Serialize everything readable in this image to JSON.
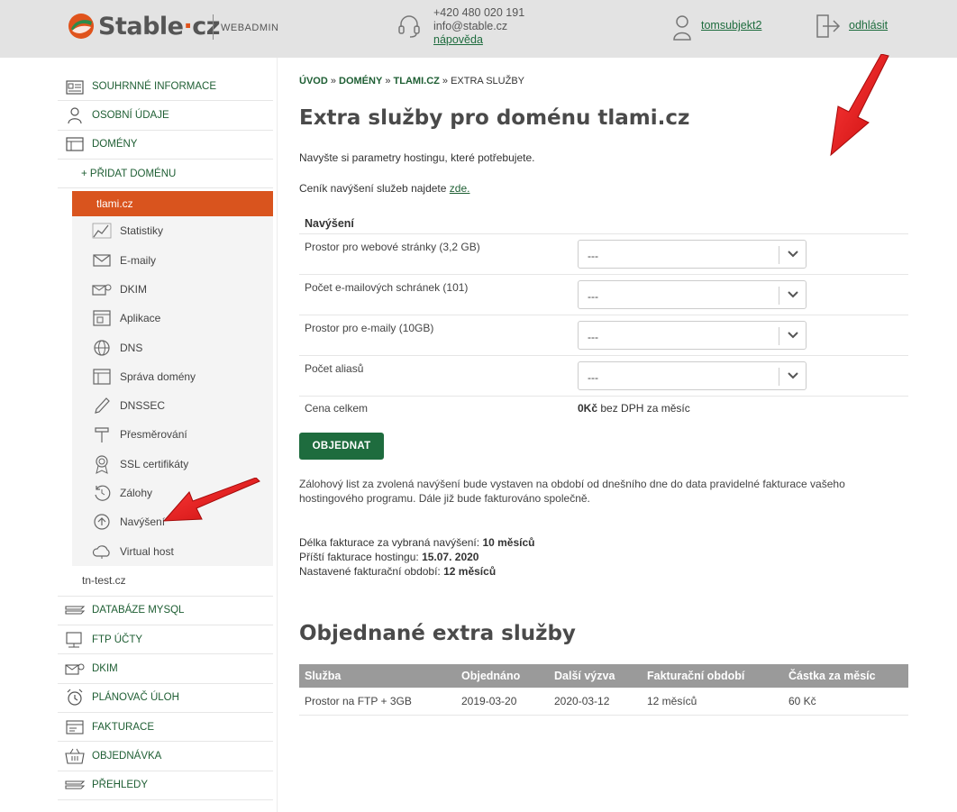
{
  "header": {
    "logo_text": "Stable",
    "logo_dot": "·",
    "logo_tld": "cz",
    "logo_sub": "WEBADMIN",
    "phone": "+420 480 020 191",
    "email": "info@stable.cz",
    "help": "nápověda",
    "user": "tomsubjekt2",
    "logout": "odhlásit"
  },
  "sidebar": {
    "items_top": [
      {
        "label": "SOUHRNNÉ INFORMACE",
        "icon": "summary-icon"
      },
      {
        "label": "OSOBNÍ ÚDAJE",
        "icon": "person-icon"
      },
      {
        "label": "DOMÉNY",
        "icon": "domains-icon"
      }
    ],
    "add_domain": "+ PŘIDAT DOMÉNU",
    "active_domain": "tlami.cz",
    "sub_items": [
      {
        "label": "Statistiky",
        "icon": "statistics-icon"
      },
      {
        "label": "E-maily",
        "icon": "mail-icon"
      },
      {
        "label": "DKIM",
        "icon": "dkim-icon"
      },
      {
        "label": "Aplikace",
        "icon": "apps-icon"
      },
      {
        "label": "DNS",
        "icon": "globe-icon"
      },
      {
        "label": "Správa domény",
        "icon": "domain-manage-icon"
      },
      {
        "label": "DNSSEC",
        "icon": "pen-icon"
      },
      {
        "label": "Přesměrování",
        "icon": "signpost-icon"
      },
      {
        "label": "SSL certifikáty",
        "icon": "certificate-icon"
      },
      {
        "label": "Zálohy",
        "icon": "backup-icon"
      },
      {
        "label": "Navýšení",
        "icon": "upgrade-icon"
      },
      {
        "label": "Virtual host",
        "icon": "cloud-icon"
      }
    ],
    "other_domain": "tn-test.cz",
    "items_bottom": [
      {
        "label": "DATABÁZE MYSQL",
        "icon": "database-icon"
      },
      {
        "label": "FTP ÚČTY",
        "icon": "ftp-icon"
      },
      {
        "label": "DKIM",
        "icon": "dkim-icon"
      },
      {
        "label": "PLÁNOVAČ ÚLOH",
        "icon": "alarm-clock-icon"
      },
      {
        "label": "FAKTURACE",
        "icon": "invoice-icon"
      },
      {
        "label": "OBJEDNÁVKA",
        "icon": "order-icon"
      },
      {
        "label": "PŘEHLEDY",
        "icon": "overview-icon"
      }
    ]
  },
  "breadcrumb": {
    "home": "ÚVOD",
    "sep": " » ",
    "domains": "DOMÉNY",
    "domain": "TLAMI.CZ",
    "current": "EXTRA SLUŽBY"
  },
  "main": {
    "title": "Extra služby pro doménu tlami.cz",
    "intro": "Navyšte si parametry hostingu, které potřebujete.",
    "price_text": "Ceník navýšení služeb najdete ",
    "price_link": "zde.",
    "table_head": "Navýšení",
    "rows": [
      {
        "label": "Prostor pro webové stránky (3,2 GB)",
        "value": "---"
      },
      {
        "label": "Počet e-mailových schránek (101)",
        "value": "---"
      },
      {
        "label": "Prostor pro e-maily (10GB)",
        "value": "---"
      },
      {
        "label": "Počet aliasů",
        "value": "---"
      }
    ],
    "total_label": "Cena celkem",
    "total_amount": "0Kč",
    "total_suffix": " bez DPH za měsíc",
    "order_button": "OBJEDNAT",
    "note": "Zálohový list za zvolená navýšení bude vystaven na období od dnešního dne do data pravidelné fakturace vašeho hostingového programu. Dále již bude fakturováno společně.",
    "billing": [
      {
        "label": "Délka fakturace za vybraná navýšení: ",
        "value": "10 měsíců"
      },
      {
        "label": "Příští fakturace hostingu: ",
        "value": "15.07. 2020"
      },
      {
        "label": "Nastavené fakturační období: ",
        "value": "12 měsíců"
      }
    ],
    "ordered_title": "Objednané extra služby",
    "ordered_headers": [
      "Služba",
      "Objednáno",
      "Další výzva",
      "Fakturační období",
      "Částka za měsíc"
    ],
    "ordered_rows": [
      [
        "Prostor na FTP + 3GB",
        "2019-03-20",
        "2020-03-12",
        "12 měsíců",
        "60 Kč"
      ]
    ]
  },
  "colors": {
    "brand_green": "#1e6c3e",
    "brand_orange": "#d9541e",
    "annotation_red": "#e01515"
  }
}
